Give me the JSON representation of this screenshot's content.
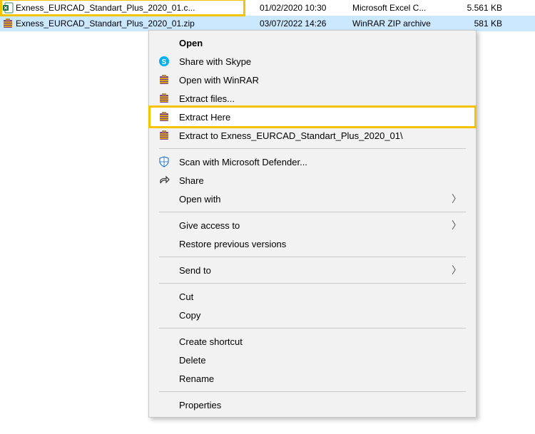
{
  "files": [
    {
      "name": "Exness_EURCAD_Standart_Plus_2020_01.c...",
      "date": "01/02/2020 10:30",
      "type": "Microsoft Excel C...",
      "size": "5.561 KB",
      "icon": "excel-icon",
      "selected": false
    },
    {
      "name": "Exness_EURCAD_Standart_Plus_2020_01.zip",
      "date": "03/07/2022 14:26",
      "type": "WinRAR ZIP archive",
      "size": "581 KB",
      "icon": "winrar-icon",
      "selected": true
    }
  ],
  "menu": {
    "open": "Open",
    "share_skype": "Share with Skype",
    "open_winrar": "Open with WinRAR",
    "extract_files": "Extract files...",
    "extract_here": "Extract Here",
    "extract_to": "Extract to Exness_EURCAD_Standart_Plus_2020_01\\",
    "scan_defender": "Scan with Microsoft Defender...",
    "share": "Share",
    "open_with": "Open with",
    "give_access": "Give access to",
    "restore_versions": "Restore previous versions",
    "send_to": "Send to",
    "cut": "Cut",
    "copy": "Copy",
    "create_shortcut": "Create shortcut",
    "delete": "Delete",
    "rename": "Rename",
    "properties": "Properties"
  }
}
